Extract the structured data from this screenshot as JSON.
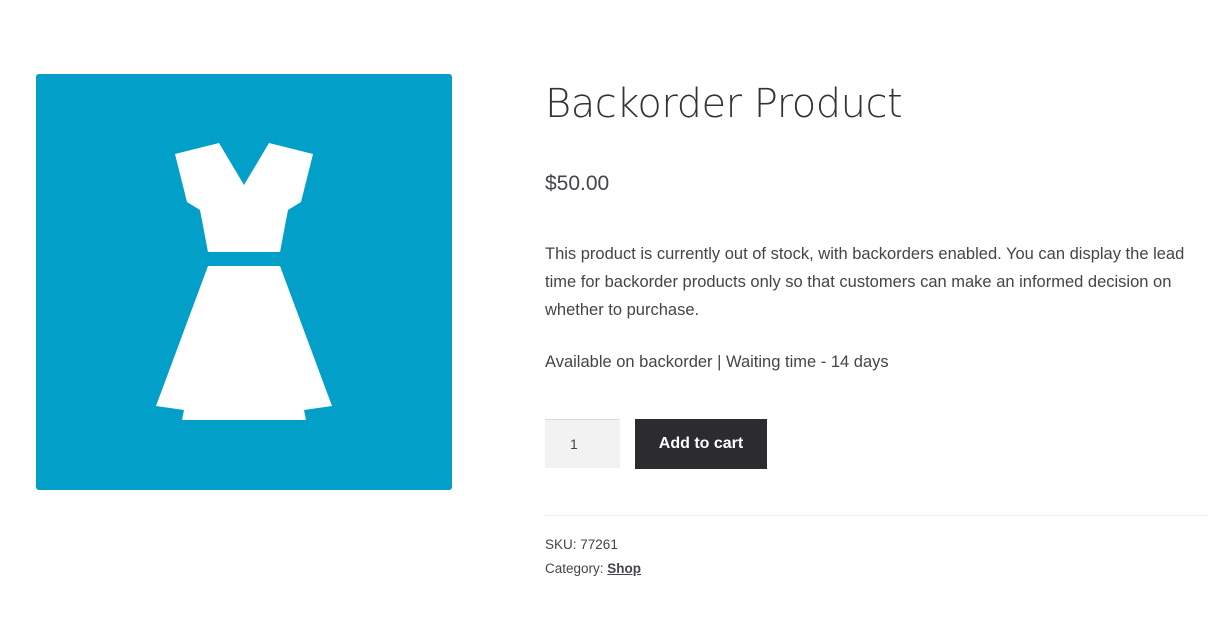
{
  "product": {
    "title": "Backorder Product",
    "price": "$50.00",
    "description": "This product is currently out of stock, with backorders enabled. You can display the lead time for backorder products only so that customers can make an informed decision on whether to purchase.",
    "stock_status": "Available on backorder | Waiting time - 14 days",
    "image": {
      "icon": "dress-icon",
      "background_color": "#02a0c9"
    }
  },
  "cart_form": {
    "quantity_value": "1",
    "add_to_cart_label": "Add to cart",
    "button_color": "#2b2b30"
  },
  "meta": {
    "sku_label": "SKU:",
    "sku_value": "77261",
    "category_label": "Category:",
    "category_value": "Shop"
  }
}
